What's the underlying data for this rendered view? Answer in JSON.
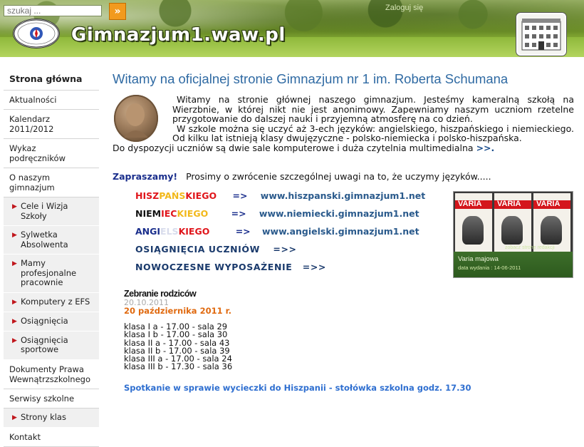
{
  "header": {
    "search_placeholder": "szukaj ...",
    "search_go_glyph": "»",
    "login_text": "Zaloguj się",
    "site_title": "Gimnazjum1.waw.pl"
  },
  "sidebar": {
    "items": [
      {
        "label": "Strona główna",
        "active": true
      },
      {
        "label": "Aktualności"
      },
      {
        "label": "Kalendarz 2011/2012"
      },
      {
        "label": "Wykaz podręczników"
      },
      {
        "label": "O naszym gimnazjum"
      }
    ],
    "sub_items": [
      {
        "label": "Cele i Wizja Szkoły"
      },
      {
        "label": "Sylwetka Absolwenta"
      },
      {
        "label": "Mamy profesjonalne pracownie"
      },
      {
        "label": "Komputery z EFS"
      },
      {
        "label": "Osiągnięcia"
      },
      {
        "label": "Osiągnięcia sportowe"
      }
    ],
    "items_after": [
      {
        "label": "Dokumenty Prawa Wewnątrzszkolnego"
      },
      {
        "label": "Serwisy szkolne"
      }
    ],
    "sub_items_after": [
      {
        "label": "Strony klas"
      }
    ],
    "items_end": [
      {
        "label": "Kontakt"
      }
    ]
  },
  "main": {
    "title": "Witamy na oficjalnej stronie Gimnazjum nr 1 im. Roberta Schumana",
    "paragraph1": "Witamy na stronie głównej naszego gimnazjum. Jesteśmy kameralną szkołą na Wierzbnie, w której nikt nie jest anonimowy. Zapewniamy naszym uczniom rzetelne przygotowanie do dalszej nauki i przyjemną atmosferę na co dzień.",
    "paragraph2": "W szkole można się uczyć aż 3-ech języków: angielskiego, hiszpańskiego i niemieckiego. Od kilku lat istnieją klasy dwujęzyczne - polsko-niemiecka i polsko-hiszpańska.",
    "paragraph3": "Do dyspozycji uczniów są dwie sale komputerowe i duża czytelnia multimedialna",
    "paragraph3_link": ">>.",
    "invite_strong": "Zapraszamy!",
    "invite_text": "Prosimy o zwrócenie szczególnej uwagi na to, że uczymy języków.....",
    "languages": {
      "hisz": {
        "p1": "HISZ",
        "p2": "PAŃS",
        "p3": "KIEGO",
        "arrow": "=>",
        "url": "www.hiszpanski.gimnazjum1.net"
      },
      "niem": {
        "p1": "NIEM",
        "p2": "IEC",
        "p3": "KIEGO",
        "arrow": "=>",
        "url": "www.niemiecki.gimnazjum1.net"
      },
      "ang": {
        "p1": "ANGI",
        "p2": "ELS",
        "p3": "KIEGO",
        "arrow": "=>",
        "url": "www.angielski.gimnazjum1.net"
      }
    },
    "achievements_link": "OSIĄGNIĘCIA UCZNIÓW",
    "achievements_arrow": "=>>",
    "equipment_link": "NOWOCZESNE WYPOSAŻENIE",
    "equipment_arrow": "=>>",
    "varia": {
      "cover_label": "VARIA",
      "title": "Varia majowa",
      "cta": "zobacz stronę redakcji",
      "date": "data wydania : 14-06-2011"
    },
    "news": {
      "title": "Zebranie rodziców",
      "date": "20.10.2011",
      "headline": "20 października 2011 r.",
      "list": [
        "klasa I a - 17.00 - sala 29",
        "klasa I b - 17.00 - sala 30",
        "klasa II a - 17.00 - sala 43",
        "klasa II b - 17.00 - sala 39",
        "klasa III a - 17.00 - sala 24",
        "klasa III b - 17.30 - sala 36"
      ],
      "link": "Spotkanie w sprawie wycieczki do Hiszpanii - stołówka szkolna godz. 17.30"
    }
  }
}
